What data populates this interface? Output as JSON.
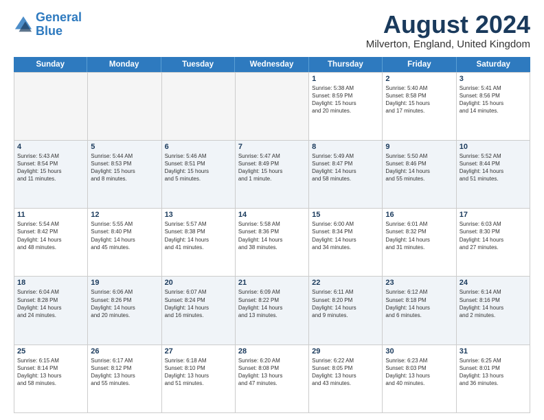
{
  "header": {
    "logo_line1": "General",
    "logo_line2": "Blue",
    "month_year": "August 2024",
    "location": "Milverton, England, United Kingdom"
  },
  "weekdays": [
    "Sunday",
    "Monday",
    "Tuesday",
    "Wednesday",
    "Thursday",
    "Friday",
    "Saturday"
  ],
  "weeks": [
    [
      {
        "day": "",
        "info": "",
        "empty": true
      },
      {
        "day": "",
        "info": "",
        "empty": true
      },
      {
        "day": "",
        "info": "",
        "empty": true
      },
      {
        "day": "",
        "info": "",
        "empty": true
      },
      {
        "day": "1",
        "info": "Sunrise: 5:38 AM\nSunset: 8:59 PM\nDaylight: 15 hours\nand 20 minutes.",
        "empty": false
      },
      {
        "day": "2",
        "info": "Sunrise: 5:40 AM\nSunset: 8:58 PM\nDaylight: 15 hours\nand 17 minutes.",
        "empty": false
      },
      {
        "day": "3",
        "info": "Sunrise: 5:41 AM\nSunset: 8:56 PM\nDaylight: 15 hours\nand 14 minutes.",
        "empty": false
      }
    ],
    [
      {
        "day": "4",
        "info": "Sunrise: 5:43 AM\nSunset: 8:54 PM\nDaylight: 15 hours\nand 11 minutes.",
        "empty": false
      },
      {
        "day": "5",
        "info": "Sunrise: 5:44 AM\nSunset: 8:53 PM\nDaylight: 15 hours\nand 8 minutes.",
        "empty": false
      },
      {
        "day": "6",
        "info": "Sunrise: 5:46 AM\nSunset: 8:51 PM\nDaylight: 15 hours\nand 5 minutes.",
        "empty": false
      },
      {
        "day": "7",
        "info": "Sunrise: 5:47 AM\nSunset: 8:49 PM\nDaylight: 15 hours\nand 1 minute.",
        "empty": false
      },
      {
        "day": "8",
        "info": "Sunrise: 5:49 AM\nSunset: 8:47 PM\nDaylight: 14 hours\nand 58 minutes.",
        "empty": false
      },
      {
        "day": "9",
        "info": "Sunrise: 5:50 AM\nSunset: 8:46 PM\nDaylight: 14 hours\nand 55 minutes.",
        "empty": false
      },
      {
        "day": "10",
        "info": "Sunrise: 5:52 AM\nSunset: 8:44 PM\nDaylight: 14 hours\nand 51 minutes.",
        "empty": false
      }
    ],
    [
      {
        "day": "11",
        "info": "Sunrise: 5:54 AM\nSunset: 8:42 PM\nDaylight: 14 hours\nand 48 minutes.",
        "empty": false
      },
      {
        "day": "12",
        "info": "Sunrise: 5:55 AM\nSunset: 8:40 PM\nDaylight: 14 hours\nand 45 minutes.",
        "empty": false
      },
      {
        "day": "13",
        "info": "Sunrise: 5:57 AM\nSunset: 8:38 PM\nDaylight: 14 hours\nand 41 minutes.",
        "empty": false
      },
      {
        "day": "14",
        "info": "Sunrise: 5:58 AM\nSunset: 8:36 PM\nDaylight: 14 hours\nand 38 minutes.",
        "empty": false
      },
      {
        "day": "15",
        "info": "Sunrise: 6:00 AM\nSunset: 8:34 PM\nDaylight: 14 hours\nand 34 minutes.",
        "empty": false
      },
      {
        "day": "16",
        "info": "Sunrise: 6:01 AM\nSunset: 8:32 PM\nDaylight: 14 hours\nand 31 minutes.",
        "empty": false
      },
      {
        "day": "17",
        "info": "Sunrise: 6:03 AM\nSunset: 8:30 PM\nDaylight: 14 hours\nand 27 minutes.",
        "empty": false
      }
    ],
    [
      {
        "day": "18",
        "info": "Sunrise: 6:04 AM\nSunset: 8:28 PM\nDaylight: 14 hours\nand 24 minutes.",
        "empty": false
      },
      {
        "day": "19",
        "info": "Sunrise: 6:06 AM\nSunset: 8:26 PM\nDaylight: 14 hours\nand 20 minutes.",
        "empty": false
      },
      {
        "day": "20",
        "info": "Sunrise: 6:07 AM\nSunset: 8:24 PM\nDaylight: 14 hours\nand 16 minutes.",
        "empty": false
      },
      {
        "day": "21",
        "info": "Sunrise: 6:09 AM\nSunset: 8:22 PM\nDaylight: 14 hours\nand 13 minutes.",
        "empty": false
      },
      {
        "day": "22",
        "info": "Sunrise: 6:11 AM\nSunset: 8:20 PM\nDaylight: 14 hours\nand 9 minutes.",
        "empty": false
      },
      {
        "day": "23",
        "info": "Sunrise: 6:12 AM\nSunset: 8:18 PM\nDaylight: 14 hours\nand 6 minutes.",
        "empty": false
      },
      {
        "day": "24",
        "info": "Sunrise: 6:14 AM\nSunset: 8:16 PM\nDaylight: 14 hours\nand 2 minutes.",
        "empty": false
      }
    ],
    [
      {
        "day": "25",
        "info": "Sunrise: 6:15 AM\nSunset: 8:14 PM\nDaylight: 13 hours\nand 58 minutes.",
        "empty": false
      },
      {
        "day": "26",
        "info": "Sunrise: 6:17 AM\nSunset: 8:12 PM\nDaylight: 13 hours\nand 55 minutes.",
        "empty": false
      },
      {
        "day": "27",
        "info": "Sunrise: 6:18 AM\nSunset: 8:10 PM\nDaylight: 13 hours\nand 51 minutes.",
        "empty": false
      },
      {
        "day": "28",
        "info": "Sunrise: 6:20 AM\nSunset: 8:08 PM\nDaylight: 13 hours\nand 47 minutes.",
        "empty": false
      },
      {
        "day": "29",
        "info": "Sunrise: 6:22 AM\nSunset: 8:05 PM\nDaylight: 13 hours\nand 43 minutes.",
        "empty": false
      },
      {
        "day": "30",
        "info": "Sunrise: 6:23 AM\nSunset: 8:03 PM\nDaylight: 13 hours\nand 40 minutes.",
        "empty": false
      },
      {
        "day": "31",
        "info": "Sunrise: 6:25 AM\nSunset: 8:01 PM\nDaylight: 13 hours\nand 36 minutes.",
        "empty": false
      }
    ]
  ]
}
